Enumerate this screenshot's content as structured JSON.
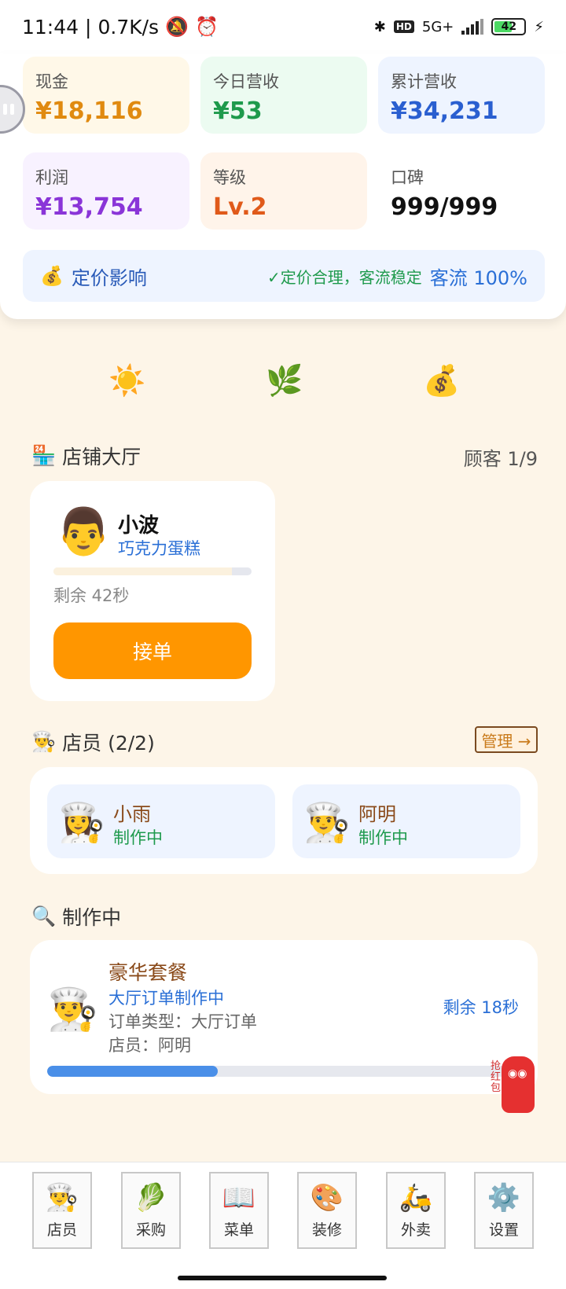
{
  "status_bar": {
    "time": "11:44",
    "speed": "0.7K/s",
    "network": "5G+",
    "battery": "42"
  },
  "stats": [
    {
      "label": "现金",
      "value": "¥18,116",
      "color": "#e08a10",
      "bg": "#fff8e8"
    },
    {
      "label": "今日营收",
      "value": "¥53",
      "color": "#1e9a4c",
      "bg": "#ecfbf1"
    },
    {
      "label": "累计营收",
      "value": "¥34,231",
      "color": "#2a5fd0",
      "bg": "#eef4ff"
    },
    {
      "label": "利润",
      "value": "¥13,754",
      "color": "#8a35d8",
      "bg": "#f8f2ff"
    },
    {
      "label": "等级",
      "value": "Lv.2",
      "color": "#e05a1a",
      "bg": "#fff4ea"
    },
    {
      "label": "口碑",
      "value": "999/999",
      "color": "#111111",
      "bg": "#ffffff"
    }
  ],
  "pricing": {
    "icon": "money-bag-icon",
    "title": "定价影响",
    "status": "✓定价合理，客流稳定",
    "flow": "客流 100%"
  },
  "weather": {
    "icons": [
      "sun-icon",
      "leaf-icon",
      "money-bag-icon"
    ]
  },
  "hall": {
    "title": "店铺大厅",
    "customers": "顾客 1/9",
    "customer": {
      "name": "小波",
      "order": "巧克力蛋糕",
      "remaining": "剩余 42秒",
      "time_fraction": 0.9,
      "accept_label": "接单"
    }
  },
  "staff": {
    "title": "店员 (2/2)",
    "manage_label": "管理 →",
    "members": [
      {
        "name": "小雨",
        "state": "制作中"
      },
      {
        "name": "阿明",
        "state": "制作中"
      }
    ]
  },
  "making": {
    "title": "制作中",
    "dish": "豪华套餐",
    "status": "大厅订单制作中",
    "order_type": "订单类型：大厅订单",
    "staff": "店员：阿明",
    "remaining": "剩余 18秒",
    "progress": 0.36
  },
  "red_packet": {
    "text": "抢红包"
  },
  "nav": [
    {
      "label": "店员",
      "icon": "chef-icon"
    },
    {
      "label": "采购",
      "icon": "vegetable-icon"
    },
    {
      "label": "菜单",
      "icon": "book-icon"
    },
    {
      "label": "装修",
      "icon": "palette-icon"
    },
    {
      "label": "外卖",
      "icon": "scooter-icon"
    },
    {
      "label": "设置",
      "icon": "gear-icon"
    }
  ]
}
